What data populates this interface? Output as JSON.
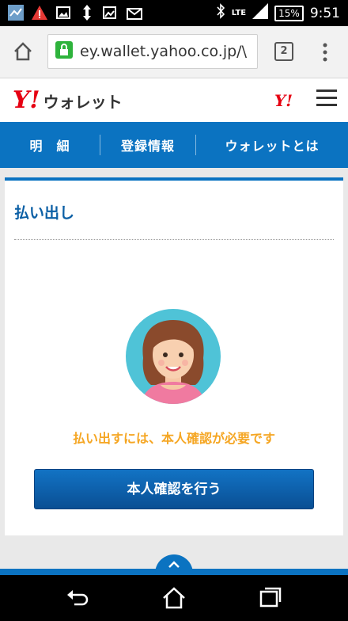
{
  "status_bar": {
    "network": "LTE",
    "battery": "15%",
    "time": "9:51"
  },
  "browser": {
    "url": "ey.wallet.yahoo.co.jp/\\",
    "tab_count": "2"
  },
  "header": {
    "logo_mark": "Y!",
    "logo_text": "ウォレット",
    "small_logo": "Y!"
  },
  "nav": {
    "items": [
      {
        "label": "明　細"
      },
      {
        "label": "登録情報"
      },
      {
        "label": "ウォレットとは"
      }
    ]
  },
  "main": {
    "title": "払い出し",
    "message": "払い出すには、本人確認が必要です",
    "button_label": "本人確認を行う"
  },
  "colors": {
    "brand_blue": "#0b73c1",
    "yahoo_red": "#e60012",
    "notice_orange": "#f5a623"
  }
}
